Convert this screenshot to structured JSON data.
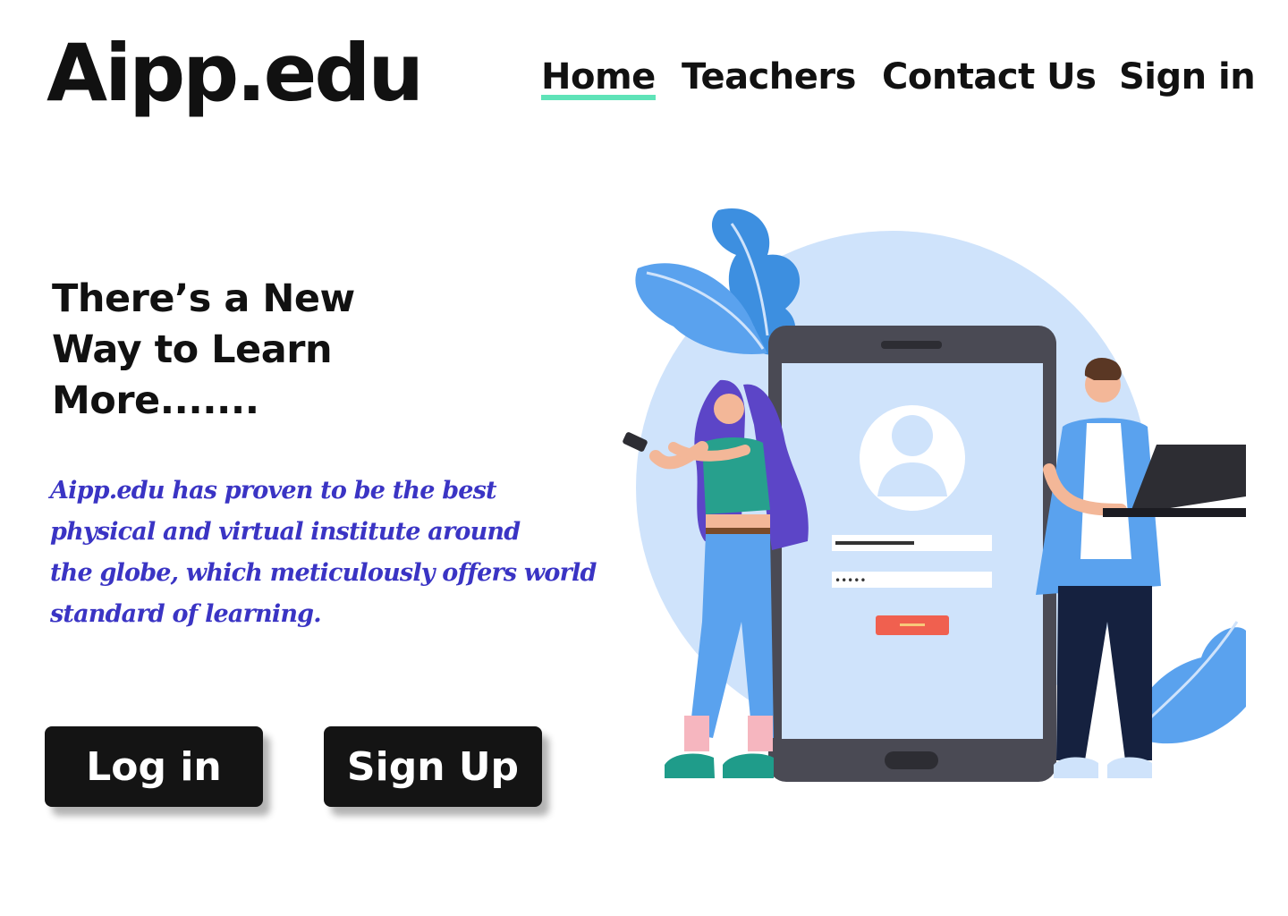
{
  "brand": {
    "logo": "Aipp.edu"
  },
  "nav": {
    "items": [
      {
        "label": "Home",
        "active": true
      },
      {
        "label": "Teachers"
      },
      {
        "label": "Contact Us"
      },
      {
        "label": "Sign in"
      }
    ],
    "active_underline_color": "#5fe3b8"
  },
  "hero": {
    "headline": "There’s a New\nWay to Learn\nMore.......",
    "tagline": "Aipp.edu has proven to be  the best\nphysical and virtual institute around\nthe globe, which meticulously offers world\nstandard of learning.",
    "tagline_color": "#3a34c4",
    "buttons": {
      "login": "Log in",
      "signup": "Sign Up"
    }
  },
  "illustration": {
    "password_mask": "•••••",
    "icons": [
      "user-avatar-icon",
      "phone-icon",
      "laptop-icon",
      "leaf-icon"
    ]
  }
}
